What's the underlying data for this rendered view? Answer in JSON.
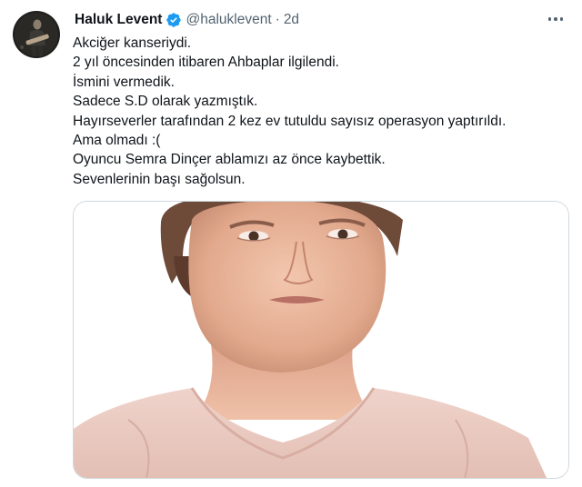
{
  "author": {
    "display_name": "Haluk Levent",
    "handle": "@haluklevent",
    "separator": "·",
    "time": "2d"
  },
  "tweet": {
    "lines": [
      "Akciğer kanseriydi.",
      "2 yıl öncesinden itibaren Ahbaplar ilgilendi.",
      "İsmini vermedik.",
      "Sadece S.D olarak yazmıştık.",
      "Hayırseverler tarafından 2 kez ev tutuldu sayısız operasyon yaptırıldı.",
      "Ama olmadı :(",
      "Oyuncu Semra Dinçer ablamızı az önce kaybettik.",
      "Sevenlerinin başı sağolsun."
    ]
  },
  "icons": {
    "verified": "verified-badge-icon",
    "more": "more-options-icon"
  },
  "colors": {
    "text": "#0f1419",
    "secondary": "#536471",
    "verified": "#1d9bf0",
    "border": "#cfd9de"
  }
}
